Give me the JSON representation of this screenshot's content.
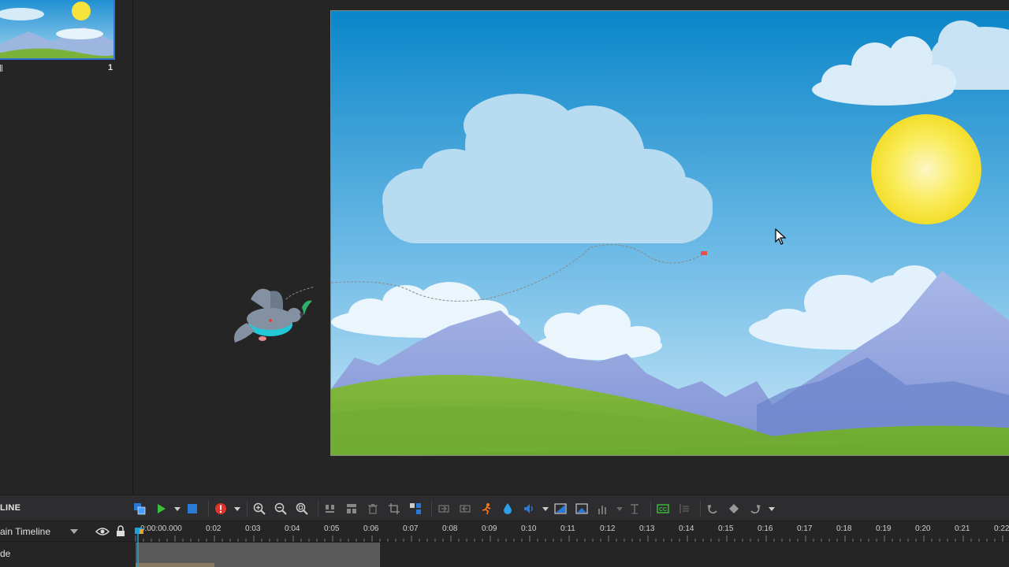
{
  "slides": {
    "items": [
      {
        "number": "1"
      }
    ]
  },
  "timeline": {
    "title": "LINE",
    "name": "ain Timeline",
    "track_label": "de",
    "ruler": [
      "0:00:00.000",
      "0:02",
      "0:03",
      "0:04",
      "0:05",
      "0:06",
      "0:07",
      "0:08",
      "0:09",
      "0:10",
      "0:11",
      "0:12",
      "0:13",
      "0:14",
      "0:15",
      "0:16",
      "0:17",
      "0:18",
      "0:19",
      "0:20",
      "0:21",
      "0:22"
    ]
  },
  "toolbar": {
    "icons": [
      "select-icon",
      "play-icon",
      "play-dropdown-icon",
      "stop-icon",
      "record-icon",
      "record-dropdown-icon",
      "zoom-in-icon",
      "zoom-out-icon",
      "zoom-fit-icon",
      "align-left-icon",
      "align-center-icon",
      "delete-icon",
      "crop-icon",
      "group-icon",
      "transition-in-icon",
      "transition-out-icon",
      "animation-icon",
      "effect-drop-icon",
      "audio-icon",
      "audio-dropdown-icon",
      "camera-icon",
      "image-icon",
      "chart-icon",
      "chart-dropdown-icon",
      "text-effect-icon",
      "closed-caption-icon",
      "marker-icon",
      "undo-icon",
      "keyframe-icon",
      "redo-icon",
      "redo-dropdown-icon"
    ]
  },
  "colors": {
    "accent": "#2f6fd8",
    "play": "#3cbf3c",
    "stop": "#2a79d4",
    "record": "#e0332b",
    "sky_top": "#0a86c9",
    "sun": "#f6e43c",
    "grass": "#7bb33a"
  }
}
